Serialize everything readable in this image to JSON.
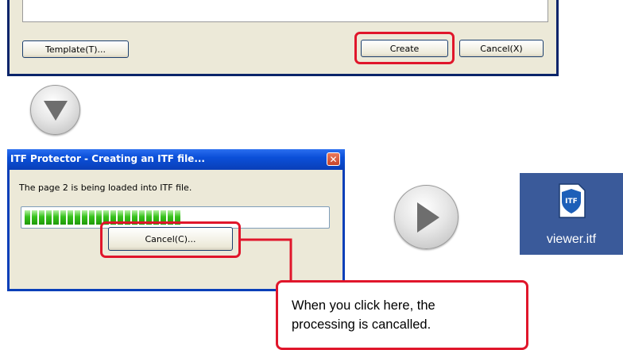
{
  "top_dialog": {
    "template_button": "Template(T)...",
    "create_button": "Create",
    "cancel_button": "Cancel(X)"
  },
  "progress_dialog": {
    "title": "ITF Protector - Creating an ITF file...",
    "close_glyph": "✕",
    "message": "The page 2 is being loaded into ITF file.",
    "progress_fraction": 0.53,
    "cancel_button": "Cancel(C)..."
  },
  "arrows": {
    "down_icon": "down-triangle",
    "play_icon": "right-triangle"
  },
  "file_tile": {
    "badge": "ITF",
    "label": "viewer.itf",
    "background": "#3a5a9a"
  },
  "callout": {
    "line1": "When you click here, the",
    "line2": "processing is cancalled."
  },
  "colors": {
    "highlight": "#e0162b",
    "progress": "#37c21c",
    "titlebar": "#0b4fd8"
  }
}
